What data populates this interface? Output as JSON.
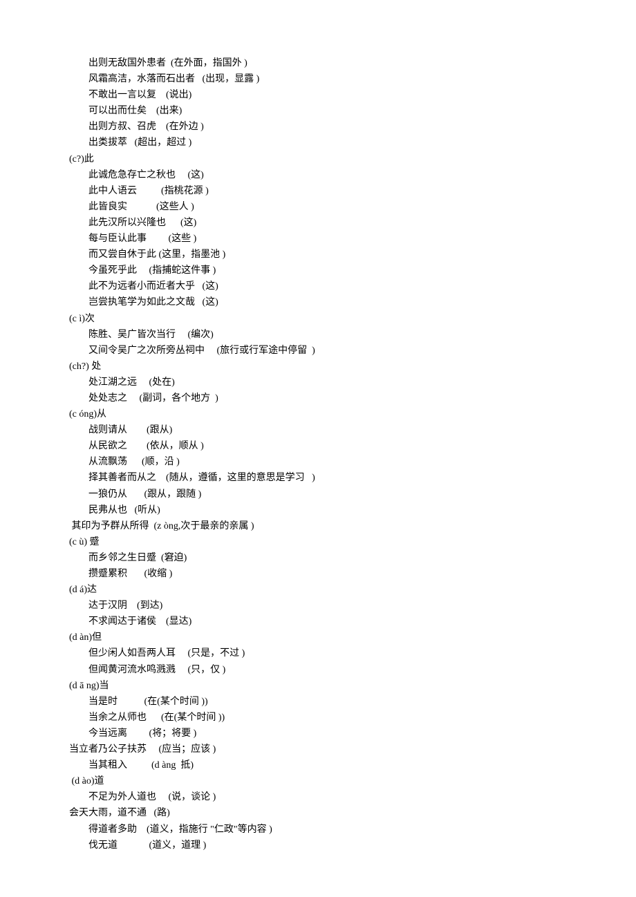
{
  "lines": [
    {
      "indent": true,
      "text": "出则无敌国外患者  (在外面，指国外 )"
    },
    {
      "indent": true,
      "text": "风霜高洁，水落而石出者   (出现，显露 )"
    },
    {
      "indent": true,
      "text": "不敢出一言以复    (说出)"
    },
    {
      "indent": true,
      "text": "可以出而仕矣    (出来)"
    },
    {
      "indent": true,
      "text": "出则方叔、召虎    (在外边 )"
    },
    {
      "indent": true,
      "text": "出类拔萃   (超出，超过 )"
    },
    {
      "indent": false,
      "text": "(c?)此"
    },
    {
      "indent": true,
      "text": "此诚危急存亡之秋也     (这)"
    },
    {
      "indent": true,
      "text": "此中人语云          (指桃花源 )"
    },
    {
      "indent": true,
      "text": "此皆良实            (这些人 )"
    },
    {
      "indent": true,
      "text": "此先汉所以兴隆也      (这)"
    },
    {
      "indent": true,
      "text": "每与臣认此事         (这些 )"
    },
    {
      "indent": true,
      "text": "而又尝自休于此 (这里，指墨池 )"
    },
    {
      "indent": true,
      "text": "今虽死乎此     (指捕蛇这件事 )"
    },
    {
      "indent": true,
      "text": "此不为远者小而近者大乎   (这)"
    },
    {
      "indent": true,
      "text": "岂尝执笔学为如此之文哉   (这)"
    },
    {
      "indent": false,
      "text": "(c ì)次"
    },
    {
      "indent": true,
      "text": "陈胜、吴广皆次当行     (编次)"
    },
    {
      "indent": true,
      "text": "又间令吴广之次所旁丛祠中     (旅行或行军途中停留  )"
    },
    {
      "indent": false,
      "text": "(ch?) 处"
    },
    {
      "indent": true,
      "text": "处江湖之远     (处在)"
    },
    {
      "indent": true,
      "text": "处处志之     (副词，各个地方  )"
    },
    {
      "indent": false,
      "text": "(c óng)从"
    },
    {
      "indent": true,
      "text": "战则请从        (跟从)"
    },
    {
      "indent": true,
      "text": "从民欲之        (依从，顺从 )"
    },
    {
      "indent": true,
      "text": "从流飘荡      (顺，沿 )"
    },
    {
      "indent": true,
      "text": "择其善者而从之    (随从，遵循，这里的意思是学习   )"
    },
    {
      "indent": true,
      "text": "一狼仍从       (跟从，跟随 )"
    },
    {
      "indent": true,
      "text": "民弗从也   (听从)"
    },
    {
      "indent": false,
      "text": " 其印为予群从所得  (z òng,次于最亲的亲属 )"
    },
    {
      "indent": false,
      "text": "(c ù) 蹙"
    },
    {
      "indent": true,
      "text": "而乡邻之生日蹙  (窘迫)"
    },
    {
      "indent": true,
      "text": "攒蹙累积       (收缩 )"
    },
    {
      "indent": false,
      "text": "(d á)达"
    },
    {
      "indent": true,
      "text": "达于汉阴    (到达)"
    },
    {
      "indent": true,
      "text": "不求闻达于诸侯    (显达)"
    },
    {
      "indent": false,
      "text": "(d àn)但"
    },
    {
      "indent": true,
      "text": "但少闲人如吾两人耳     (只是，不过 )"
    },
    {
      "indent": true,
      "text": "但闻黄河流水鸣溅溅     (只，仅 )"
    },
    {
      "indent": false,
      "text": "(d ā ng)当"
    },
    {
      "indent": true,
      "text": "当是时           (在(某个时间 ))"
    },
    {
      "indent": true,
      "text": "当余之从师也      (在(某个时间 ))"
    },
    {
      "indent": true,
      "text": "今当远离         (将；将要 )"
    },
    {
      "indent": false,
      "text": "当立者乃公子扶苏     (应当；应该 )"
    },
    {
      "indent": true,
      "text": "当其租入          (d àng  抵)"
    },
    {
      "indent": false,
      "text": " (d ào)道"
    },
    {
      "indent": true,
      "text": "不足为外人道也     (说，谈论 )"
    },
    {
      "indent": false,
      "text": "会天大雨，道不通   (路)"
    },
    {
      "indent": true,
      "text": "得道者多助    (道义，指施行 \"仁政\"等内容 )"
    },
    {
      "indent": true,
      "text": "伐无道             (道义，道理 )"
    }
  ]
}
